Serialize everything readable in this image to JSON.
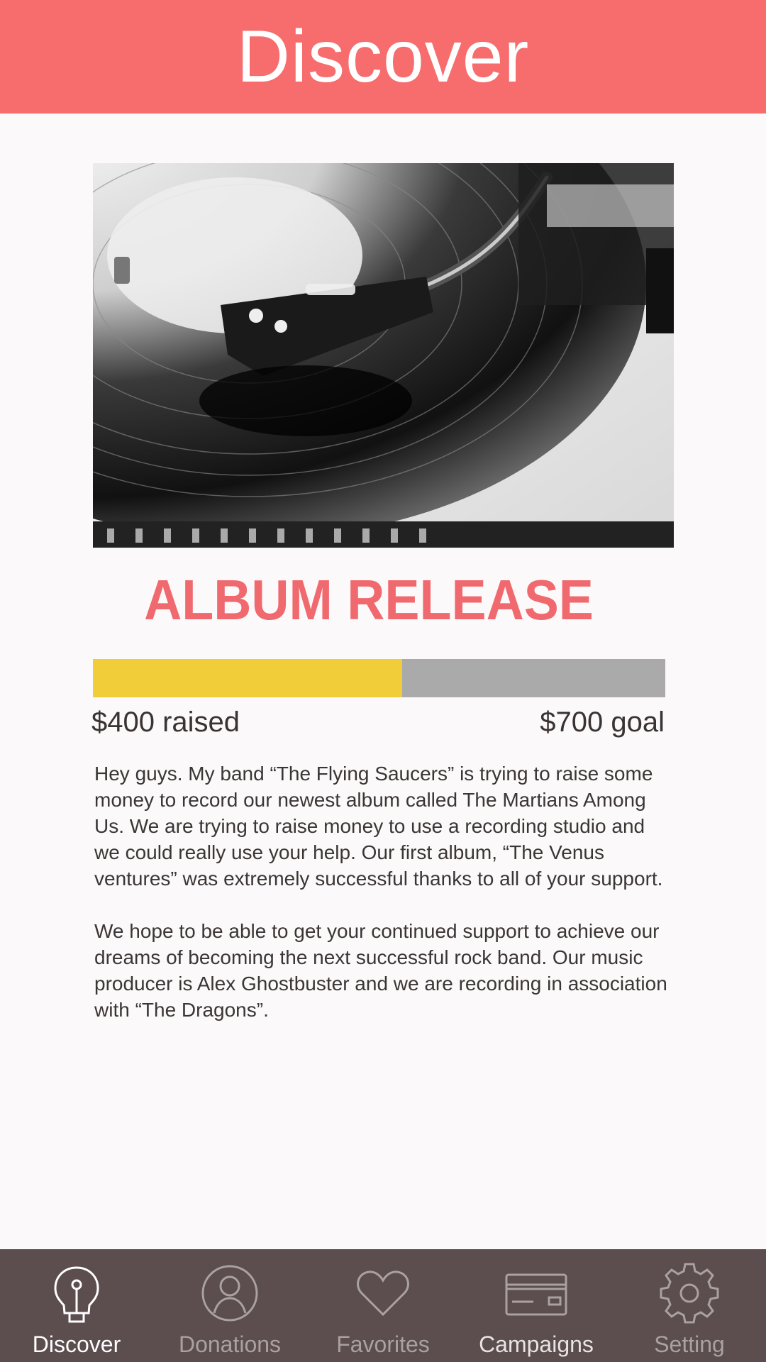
{
  "header": {
    "title": "Discover"
  },
  "campaign": {
    "title": "ALBUM RELEASE",
    "raised_label": "$400 raised",
    "goal_label": "$700 goal",
    "raised_amount": 400,
    "goal_amount": 700,
    "progress_fraction": 0.54,
    "colors": {
      "accent": "#f76d6d",
      "title": "#f0696e",
      "progress_fill": "#f2cd3a",
      "progress_track": "#aaaaaa"
    },
    "description": [
      "Hey guys. My band “The Flying Saucers” is trying to raise some money to record our newest album called The Martians Among Us. We are trying to raise money to use a recording studio and we could really use your help. Our first album, “The Venus ventures” was extremely successful thanks to all of your support.",
      "We hope to be able to get your continued support to achieve our dreams of becoming the next successful rock band. Our music producer is Alex Ghostbuster and we are recording in association with “The Dragons”."
    ]
  },
  "tabbar": {
    "background": "#5c4d4f",
    "items": [
      {
        "label": "Discover",
        "icon": "lightbulb-icon",
        "active": true
      },
      {
        "label": "Donations",
        "icon": "user-icon",
        "active": false
      },
      {
        "label": "Favorites",
        "icon": "heart-icon",
        "active": false
      },
      {
        "label": "Campaigns",
        "icon": "credit-card-icon",
        "active": false
      },
      {
        "label": "Setting",
        "icon": "gear-icon",
        "active": false
      }
    ]
  }
}
